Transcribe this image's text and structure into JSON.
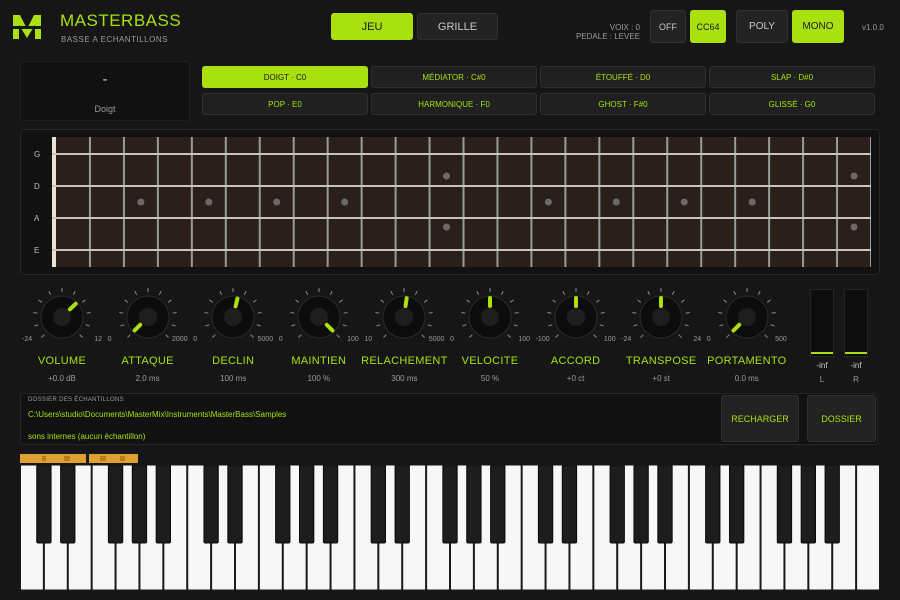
{
  "colors": {
    "accent": "#a8e10f",
    "background": "#161616",
    "panel": "#111111",
    "fretboard": "#2a1f1a",
    "key_range": "#e0a030"
  },
  "header": {
    "logo_icon": "masterbass-m-logo",
    "title": "MASTERBASS",
    "subtitle": "BASSE A ECHANTILLONS",
    "tabs": [
      {
        "label": "JEU",
        "active": true
      },
      {
        "label": "GRILLE",
        "active": false
      }
    ],
    "voice_line": "VOIX : 0",
    "pedal_line": "PEDALE : LEVEE",
    "sustain_off_label": "OFF",
    "cc64_label": "CC64",
    "cc64_active": true,
    "poly_label": "POLY",
    "mono_label": "MONO",
    "mono_active": true,
    "version": "v1.0.0"
  },
  "articulation": {
    "current": "-",
    "mode": "Doigt",
    "buttons": [
      {
        "label": "DOIGT · C0",
        "active": true
      },
      {
        "label": "MÉDIATOR · C#0",
        "active": false
      },
      {
        "label": "ÉTOUFFÉ · D0",
        "active": false
      },
      {
        "label": "SLAP · D#0",
        "active": false
      },
      {
        "label": "POP · E0",
        "active": false
      },
      {
        "label": "HARMONIQUE · F0",
        "active": false
      },
      {
        "label": "GHOST · F#0",
        "active": false
      },
      {
        "label": "GLISSÉ · G0",
        "active": false
      }
    ]
  },
  "fretboard": {
    "strings": [
      "G",
      "D",
      "A",
      "E"
    ],
    "fret_count": 24,
    "single_dot_frets": [
      3,
      5,
      7,
      9,
      15,
      17,
      19,
      21
    ],
    "double_dot_frets": [
      12,
      24
    ]
  },
  "knobs": [
    {
      "name": "VOLUME",
      "min": "-24",
      "max": "12",
      "value": "+0.0 dB",
      "level": 0.67
    },
    {
      "name": "ATTAQUE",
      "min": "0",
      "max": "2000",
      "value": "2.0 ms",
      "level": 0.0
    },
    {
      "name": "DECLIN",
      "min": "0",
      "max": "5000",
      "value": "100 ms",
      "level": 0.55
    },
    {
      "name": "MAINTIEN",
      "min": "0",
      "max": "100",
      "value": "100 %",
      "level": 1.0
    },
    {
      "name": "RELACHEMENT",
      "min": "10",
      "max": "5000",
      "value": "300 ms",
      "level": 0.53
    },
    {
      "name": "VELOCITE",
      "min": "0",
      "max": "100",
      "value": "50 %",
      "level": 0.5
    },
    {
      "name": "ACCORD",
      "min": "-100",
      "max": "100",
      "value": "+0 ct",
      "level": 0.5
    },
    {
      "name": "TRANSPOSE",
      "min": "-24",
      "max": "24",
      "value": "+0 st",
      "level": 0.5
    },
    {
      "name": "PORTAMENTO",
      "min": "0",
      "max": "500",
      "value": "0.0 ms",
      "level": 0.0
    }
  ],
  "meters": [
    {
      "value": "-inf",
      "channel": "L"
    },
    {
      "value": "-inf",
      "channel": "R"
    }
  ],
  "samples": {
    "caption": "DOSSIER DES ÉCHANTILLONS",
    "path": "C:\\Users\\studio\\Documents\\MasterMix\\Instruments\\MasterBass\\Samples",
    "status": "sons internes (aucun échantillon)",
    "reload_label": "RECHARGER",
    "folder_label": "DOSSIER"
  },
  "keyboard": {
    "white_key_count": 36,
    "key_range_icon": "key-range-bar"
  }
}
